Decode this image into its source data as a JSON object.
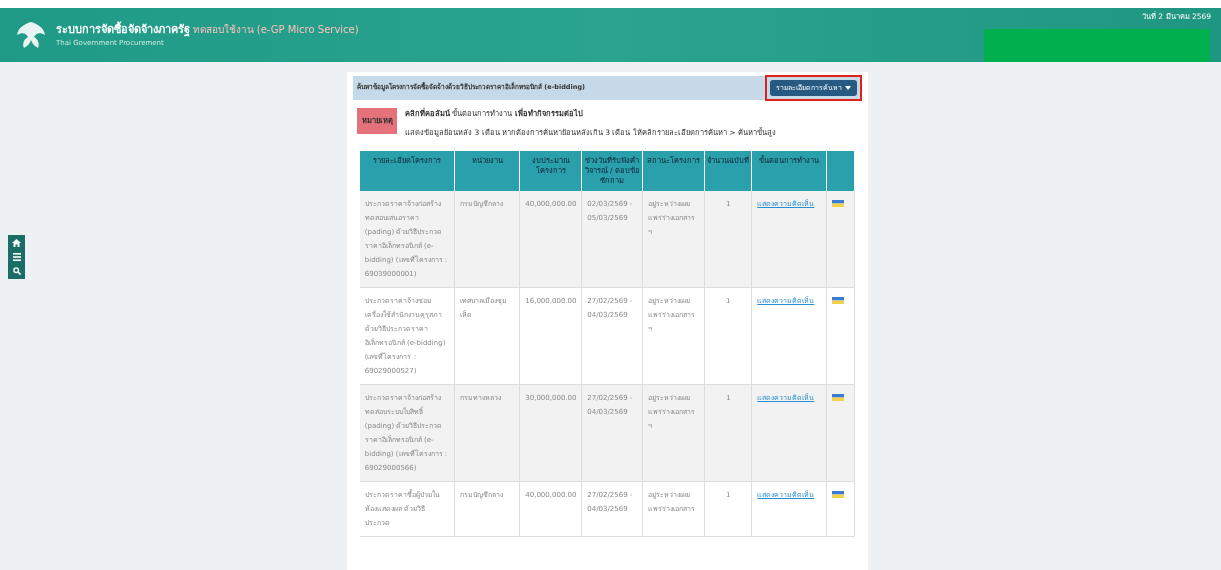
{
  "header": {
    "title": "ระบบการจัดซื้อจัดจ้างภาครัฐ",
    "tag": "ทดสอบใช้งาน (e-GP Micro Service)",
    "subtitle": "Thai Government Procurement",
    "date": "วันที่ 2 มีนาคม 2569"
  },
  "panel": {
    "title": "ค้นหาข้อมูลโครงการจัดซื้อจัดจ้างด้วยวิธีประกวดราคาอิเล็กทรอนิกส์ (e-bidding)",
    "search_button": {
      "label": "รายละเอียดการค้นหา",
      "highlighted": true
    },
    "note": {
      "badge": "หมายเหตุ",
      "lines": [
        "**คลิกที่คอลัมน์** ขั้นตอนการทำงาน **เพื่อทำกิจกรรมต่อไป**",
        "แสดงข้อมูลย้อนหลัง 3 เดือน หากต้องการค้นหาย้อนหลังเกิน 3 เดือน ให้คลิกรายละเอียดการค้นหา > ค้นหาขั้นสูง"
      ]
    }
  },
  "table": {
    "columns": [
      "รายละเอียดโครงการ",
      "หน่วยงาน",
      "งบประมาณโครงการ",
      "ช่วงวันที่รับฟังคำวิจารณ์ / ตอบข้อซักถาม",
      "สถานะโครงการ",
      "จำนวนฉบับที่",
      "ขั้นตอนการทำงาน"
    ],
    "rows": [
      {
        "project": "ประกวดราคาจ้างก่อสร้าง ทดสอบเสนอราคา (pading) ด้วยวิธีประกวดราคาอิเล็กทรอนิกส์ (e-bidding) (เลขที่โครงการ : 69039000001)",
        "agency": "กรมบัญชีกลาง",
        "budget": "40,000,000.00",
        "period": "02/03/2569 - 05/03/2569",
        "status": "อยู่ระหว่างเผยแพร่ร่างเอกสาร ฯ",
        "count": "1",
        "action": "แสดงความคิดเห็น"
      },
      {
        "project": "ประกวดราคาจ้างซ่อมเครื่องใช้สำนักงานคุรุสภา ด้วยวิธีประกวดราคาอิเล็กทรอนิกส์ (e-bidding)(เลขที่โครงการ : 69029000527)",
        "agency": "เทศบาลเมืองชุมเห็ด",
        "budget": "16,000,000.00",
        "period": "27/02/2569 - 04/03/2569",
        "status": "อยู่ระหว่างเผยแพร่ร่างเอกสาร ฯ",
        "count": "1",
        "action": "แสดงความคิดเห็น"
      },
      {
        "project": "ประกวดราคาจ้างก่อสร้าง ทดสอบระบบใบสิทธิ์ (pading) ด้วยวิธีประกวดราคาอิเล็กทรอนิกส์ (e-bidding) (เลขที่โครงการ : 69029000566)",
        "agency": "กรมทางหลวง",
        "budget": "30,000,000.00",
        "period": "27/02/2569 - 04/03/2569",
        "status": "อยู่ระหว่างเผยแพร่ร่างเอกสาร ฯ",
        "count": "1",
        "action": "แสดงความคิดเห็น"
      },
      {
        "project": "ประกวดราคาซื้อผู้ป่วยใน ห้องแสดงผล ด้วยวิธีประกวด",
        "agency": "กรมบัญชีกลาง",
        "budget": "40,000,000.00",
        "period": "27/02/2569 - 04/03/2569",
        "status": "อยู่ระหว่างเผยแพร่ร่างเอกสาร",
        "count": "1",
        "action": "แสดงความคิดเห็น"
      }
    ]
  }
}
